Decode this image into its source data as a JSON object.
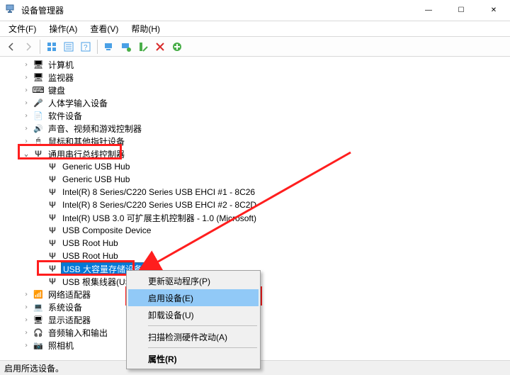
{
  "window": {
    "title": "设备管理器",
    "min": "—",
    "max": "☐",
    "close": "✕"
  },
  "menu": {
    "file": "文件(F)",
    "action": "操作(A)",
    "view": "查看(V)",
    "help": "帮助(H)"
  },
  "status": "启用所选设备。",
  "tree": {
    "computer": "计算机",
    "monitor": "监视器",
    "keyboard": "键盘",
    "hid": "人体学输入设备",
    "software": "软件设备",
    "sound": "声音、视频和游戏控制器",
    "mouse": "鼠标和其他指针设备",
    "usbRoot": "通用串行总线控制器",
    "usb": {
      "0": "Generic USB Hub",
      "1": "Generic USB Hub",
      "2": "Intel(R) 8 Series/C220 Series USB EHCI #1 - 8C26",
      "3": "Intel(R) 8 Series/C220 Series USB EHCI #2 - 8C2D",
      "4": "Intel(R) USB 3.0 可扩展主机控制器 - 1.0 (Microsoft)",
      "5": "USB Composite Device",
      "6": "USB Root Hub",
      "7": "USB Root Hub",
      "8": "USB 大容量存储设备",
      "9": "USB 根集线器(USB"
    },
    "network": "网络适配器",
    "system": "系统设备",
    "display": "显示适配器",
    "audio": "音频输入和输出",
    "camera": "照相机"
  },
  "context": {
    "update": "更新驱动程序(P)",
    "enable": "启用设备(E)",
    "uninstall": "卸载设备(U)",
    "scan": "扫描检测硬件改动(A)",
    "properties": "属性(R)"
  }
}
